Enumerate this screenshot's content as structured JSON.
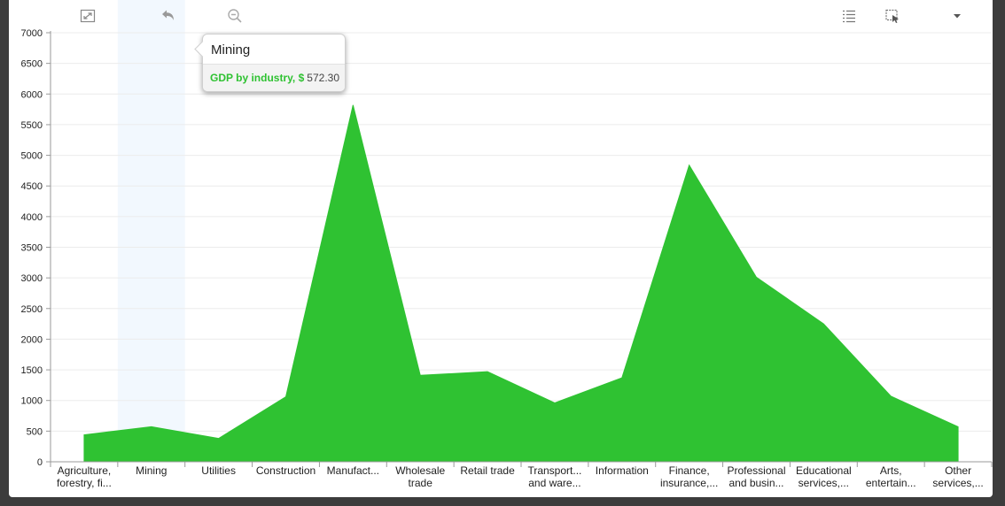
{
  "chart_data": {
    "type": "area",
    "categories": [
      [
        "Agriculture,",
        "forestry, fi..."
      ],
      [
        "Mining"
      ],
      [
        "Utilities"
      ],
      [
        "Construction"
      ],
      [
        "Manufact..."
      ],
      [
        "Wholesale",
        "trade"
      ],
      [
        "Retail trade"
      ],
      [
        "Transport...",
        "and ware..."
      ],
      [
        "Information"
      ],
      [
        "Finance,",
        "insurance,..."
      ],
      [
        "Professional",
        "and busin..."
      ],
      [
        "Educational",
        "services,..."
      ],
      [
        "Arts,",
        "entertain..."
      ],
      [
        "Other",
        "services,..."
      ]
    ],
    "series": [
      {
        "name": "GDP by industry, $",
        "color": "#2fc232",
        "values": [
          440,
          572.3,
          380,
          1060,
          5820,
          1410,
          1470,
          960,
          1370,
          4840,
          3010,
          2250,
          1070,
          570
        ]
      }
    ],
    "ylim": [
      0,
      7000
    ],
    "yticks": [
      "0",
      "500",
      "1000",
      "1500",
      "2000",
      "2500",
      "3000",
      "3500",
      "4000",
      "4500",
      "5000",
      "5500",
      "6000",
      "6500",
      "7000"
    ],
    "grid": true,
    "highlighted_category_index": 1
  },
  "tooltip": {
    "title": "Mining",
    "series_label": "GDP by industry, $",
    "value": "572.30",
    "series_color": "#2fc232"
  },
  "toolbar": {
    "icons": [
      "fullscreen-icon",
      "undo-icon",
      "zoom-out-icon",
      "legend-list-icon",
      "selection-icon",
      "dropdown-icon"
    ]
  }
}
